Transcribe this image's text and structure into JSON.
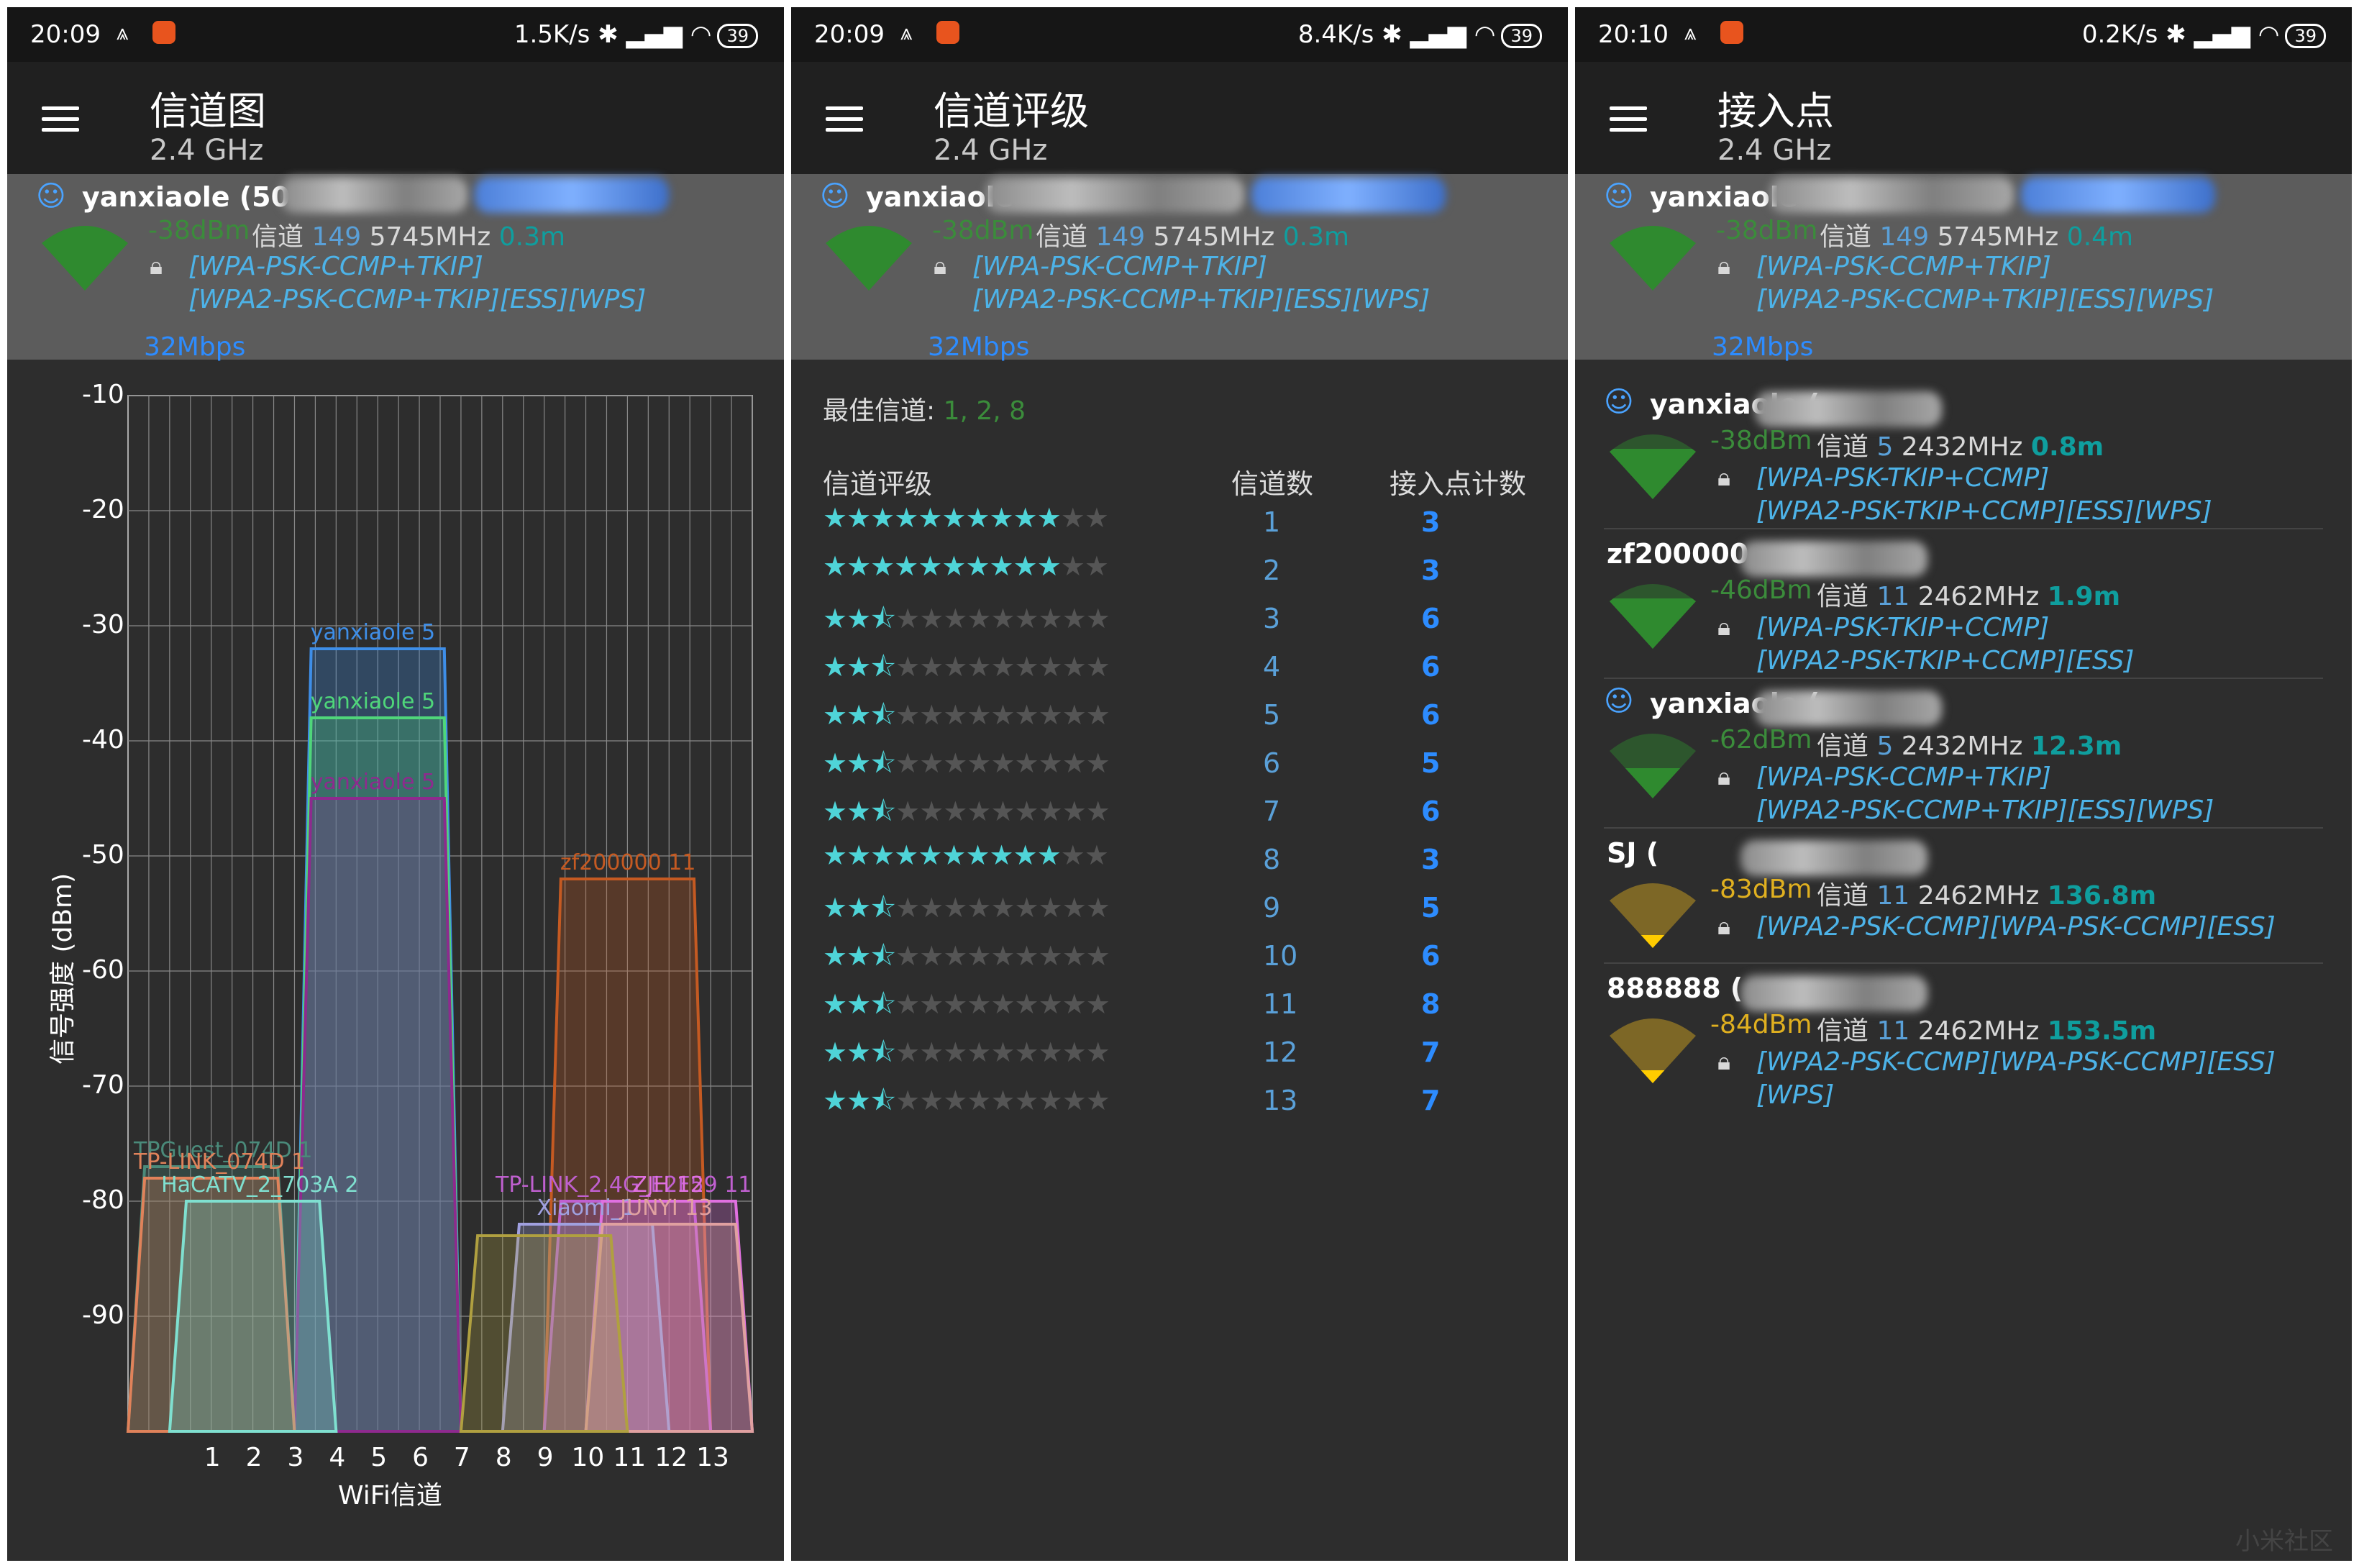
{
  "panels": [
    {
      "status": {
        "time": "20:09",
        "speed": "1.5K/s",
        "battery": "39"
      },
      "appbar": {
        "title": "信道图",
        "subtitle": "2.4 GHz"
      },
      "connected": {
        "ssid": "yanxiaole (50",
        "rsl": "-38dBm",
        "channel_label": "信道",
        "channel": "149",
        "freq": "5745MHz",
        "distance": "0.3m",
        "sec1": "[WPA-PSK-CCMP+TKIP]",
        "sec2": "[WPA2-PSK-CCMP+TKIP][ESS][WPS]",
        "link_speed": "32Mbps"
      }
    },
    {
      "status": {
        "time": "20:09",
        "speed": "8.4K/s",
        "battery": "39"
      },
      "appbar": {
        "title": "信道评级",
        "subtitle": "2.4 GHz"
      },
      "connected": {
        "ssid": "yanxiaole",
        "rsl": "-38dBm",
        "channel_label": "信道",
        "channel": "149",
        "freq": "5745MHz",
        "distance": "0.3m",
        "sec1": "[WPA-PSK-CCMP+TKIP]",
        "sec2": "[WPA2-PSK-CCMP+TKIP][ESS][WPS]",
        "link_speed": "32Mbps"
      }
    },
    {
      "status": {
        "time": "20:10",
        "speed": "0.2K/s",
        "battery": "39"
      },
      "appbar": {
        "title": "接入点",
        "subtitle": "2.4 GHz"
      },
      "connected": {
        "ssid": "yanxiaole",
        "rsl": "-38dBm",
        "channel_label": "信道",
        "channel": "149",
        "freq": "5745MHz",
        "distance": "0.4m",
        "sec1": "[WPA-PSK-CCMP+TKIP]",
        "sec2": "[WPA2-PSK-CCMP+TKIP][ESS][WPS]",
        "link_speed": "32Mbps"
      }
    }
  ],
  "chart_data": {
    "type": "area",
    "xlabel": "WiFi信道",
    "ylabel": "信号强度 (dBm)",
    "x_ticks": [
      "1",
      "2",
      "3",
      "4",
      "5",
      "6",
      "7",
      "8",
      "9",
      "10",
      "11",
      "12",
      "13"
    ],
    "y_ticks": [
      "-10",
      "-20",
      "-30",
      "-40",
      "-50",
      "-60",
      "-70",
      "-80",
      "-90"
    ],
    "ylim": [
      -100,
      -10
    ],
    "series": [
      {
        "name": "yanxiaole 5",
        "channel": 5,
        "dbm": -32,
        "color": "#3e8ee8"
      },
      {
        "name": "yanxiaole 5",
        "channel": 5,
        "dbm": -38,
        "color": "#4fd67a"
      },
      {
        "name": "yanxiaole 5",
        "channel": 5,
        "dbm": -45,
        "color": "#8e2a8e"
      },
      {
        "name": "zf200000 11",
        "channel": 11,
        "dbm": -52,
        "color": "#c55a22"
      },
      {
        "name": "TPGuest_074D 1",
        "channel": 1,
        "dbm": -77,
        "color": "#4a8a7a"
      },
      {
        "name": "TP-LINK_074D 1",
        "channel": 1,
        "dbm": -78,
        "color": "#e0825a"
      },
      {
        "name": "HaCATV_2_703A 2",
        "channel": 2,
        "dbm": -80,
        "color": "#7fe0d0"
      },
      {
        "name": "TP-LINK_2.4G_E2F59 11",
        "channel": 11,
        "dbm": -80,
        "color": "#c060d0"
      },
      {
        "name": "ZJH 12",
        "channel": 12,
        "dbm": -80,
        "color": "#e070e0"
      },
      {
        "name": "Xiaomi_1",
        "channel": 10,
        "dbm": -82,
        "color": "#a0a0e0"
      },
      {
        "name": "JUNYI 13",
        "channel": 12,
        "dbm": -82,
        "color": "#e0a0a0"
      },
      {
        "name": "",
        "channel": 9,
        "dbm": -83,
        "color": "#b0a040"
      }
    ]
  },
  "rating": {
    "best_label": "最佳信道:",
    "best_value": "1, 2, 8",
    "col_rating": "信道评级",
    "col_channel": "信道数",
    "col_count": "接入点计数",
    "rows": [
      {
        "channel": "1",
        "count": "3",
        "stars": 10
      },
      {
        "channel": "2",
        "count": "3",
        "stars": 10
      },
      {
        "channel": "3",
        "count": "6",
        "stars": 2.5
      },
      {
        "channel": "4",
        "count": "6",
        "stars": 2.5
      },
      {
        "channel": "5",
        "count": "6",
        "stars": 2.5
      },
      {
        "channel": "6",
        "count": "5",
        "stars": 2.5
      },
      {
        "channel": "7",
        "count": "6",
        "stars": 2.5
      },
      {
        "channel": "8",
        "count": "3",
        "stars": 10
      },
      {
        "channel": "9",
        "count": "5",
        "stars": 2.5
      },
      {
        "channel": "10",
        "count": "6",
        "stars": 2.5
      },
      {
        "channel": "11",
        "count": "8",
        "stars": 2.5
      },
      {
        "channel": "12",
        "count": "7",
        "stars": 2.5
      },
      {
        "channel": "13",
        "count": "7",
        "stars": 2.5
      }
    ]
  },
  "access_points": [
    {
      "name": "yanxiaole (",
      "rsl": "-38dBm",
      "channel_label": "信道",
      "channel": "5",
      "freq": "2432MHz",
      "distance": "0.8m",
      "sec1": "[WPA-PSK-TKIP+CCMP]",
      "sec2": "[WPA2-PSK-TKIP+CCMP][ESS][WPS]"
    },
    {
      "name": "zf200000",
      "rsl": "-46dBm",
      "channel_label": "信道",
      "channel": "11",
      "freq": "2462MHz",
      "distance": "1.9m",
      "sec1": "[WPA-PSK-TKIP+CCMP]",
      "sec2": "[WPA2-PSK-TKIP+CCMP][ESS]"
    },
    {
      "name": "yanxiaole (",
      "rsl": "-62dBm",
      "channel_label": "信道",
      "channel": "5",
      "freq": "2432MHz",
      "distance": "12.3m",
      "sec1": "[WPA-PSK-CCMP+TKIP]",
      "sec2": "[WPA2-PSK-CCMP+TKIP][ESS][WPS]"
    },
    {
      "name": "SJ (",
      "rsl": "-83dBm",
      "channel_label": "信道",
      "channel": "11",
      "freq": "2462MHz",
      "distance": "136.8m",
      "sec1": "[WPA2-PSK-CCMP][WPA-PSK-CCMP][ESS]",
      "sec2": ""
    },
    {
      "name": "888888 (",
      "rsl": "-84dBm",
      "channel_label": "信道",
      "channel": "11",
      "freq": "2462MHz",
      "distance": "153.5m",
      "sec1": "[WPA2-PSK-CCMP][WPA-PSK-CCMP][ESS]",
      "sec2": "[WPS]"
    }
  ],
  "watermark": "小米社区"
}
